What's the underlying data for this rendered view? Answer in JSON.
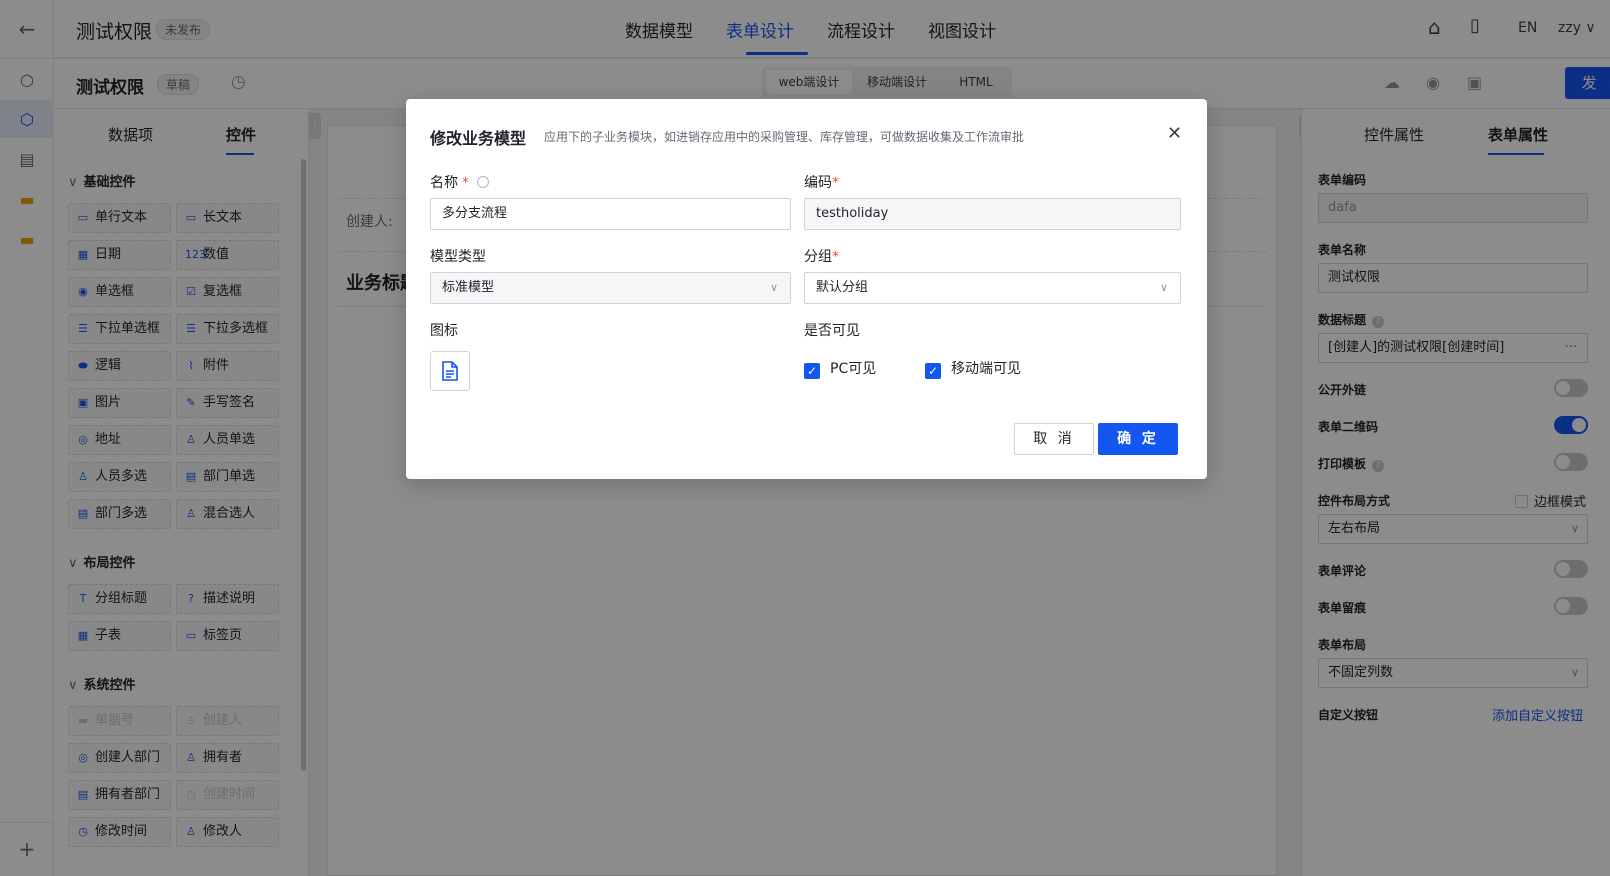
{
  "rail": {
    "back_icon": "arrow-left-icon",
    "search_icon": "search-icon",
    "cube_icon": "cube-icon",
    "doc_icon": "document-icon",
    "folder_icon": "folder-icon",
    "add_icon": "plus-icon",
    "glyphs": {
      "back": "←",
      "search": "○",
      "cube": "⬡",
      "doc": "▤",
      "folder": "▬",
      "add": "+"
    }
  },
  "header": {
    "app_title": "测试权限",
    "status_badge": "未发布",
    "nav_tabs": [
      "数据模型",
      "表单设计",
      "流程设计",
      "视图设计"
    ],
    "active_tab": "表单设计",
    "lang": "EN",
    "user": "zzy ∨",
    "home_glyph": "⌂",
    "book_glyph": "▯"
  },
  "toolbar": {
    "form_title": "测试权限",
    "draft_badge": "草稿",
    "history_glyph": "◷",
    "modes": [
      "web端设计",
      "移动端设计",
      "HTML"
    ],
    "active_mode": "web端设计",
    "icons": {
      "upload": "☁",
      "preview": "◉",
      "save": "▣"
    },
    "publish_label": "发 布"
  },
  "left_panel": {
    "tabs": [
      "数据项",
      "控件"
    ],
    "active_tab": "控件",
    "chevron": "∨",
    "sections": [
      {
        "title": "基础控件",
        "items": [
          {
            "label": "单行文本",
            "glyph": "▭"
          },
          {
            "label": "长文本",
            "glyph": "▭"
          },
          {
            "label": "日期",
            "glyph": "▦"
          },
          {
            "label": "数值",
            "glyph": "123"
          },
          {
            "label": "单选框",
            "glyph": "◉"
          },
          {
            "label": "复选框",
            "glyph": "☑"
          },
          {
            "label": "下拉单选框",
            "glyph": "☰"
          },
          {
            "label": "下拉多选框",
            "glyph": "☰"
          },
          {
            "label": "逻辑",
            "glyph": "⬬"
          },
          {
            "label": "附件",
            "glyph": "⌇"
          },
          {
            "label": "图片",
            "glyph": "▣"
          },
          {
            "label": "手写签名",
            "glyph": "✎"
          },
          {
            "label": "地址",
            "glyph": "◎"
          },
          {
            "label": "人员单选",
            "glyph": "♙"
          },
          {
            "label": "人员多选",
            "glyph": "♙"
          },
          {
            "label": "部门单选",
            "glyph": "▤"
          },
          {
            "label": "部门多选",
            "glyph": "▤"
          },
          {
            "label": "混合选人",
            "glyph": "♙"
          }
        ]
      },
      {
        "title": "布局控件",
        "items": [
          {
            "label": "分组标题",
            "glyph": "T"
          },
          {
            "label": "描述说明",
            "glyph": "?"
          },
          {
            "label": "子表",
            "glyph": "▦"
          },
          {
            "label": "标签页",
            "glyph": "▭"
          }
        ]
      },
      {
        "title": "系统控件",
        "items": [
          {
            "label": "单据号",
            "glyph": "▬",
            "disabled": true
          },
          {
            "label": "创建人",
            "glyph": "♙",
            "disabled": true
          },
          {
            "label": "创建人部门",
            "glyph": "◎"
          },
          {
            "label": "拥有者",
            "glyph": "♙"
          },
          {
            "label": "拥有者部门",
            "glyph": "▤"
          },
          {
            "label": "创建时间",
            "glyph": "◷",
            "disabled": true
          },
          {
            "label": "修改时间",
            "glyph": "◷"
          },
          {
            "label": "修改人",
            "glyph": "♙"
          }
        ]
      }
    ]
  },
  "canvas": {
    "creator_label": "创建人:",
    "business_title": "业务标题"
  },
  "right_panel": {
    "tabs": [
      "控件属性",
      "表单属性"
    ],
    "active_tab": "表单属性",
    "form_code_label": "表单编码",
    "form_code_value": "dafa",
    "form_name_label": "表单名称",
    "form_name_value": "测试权限",
    "data_title_label": "数据标题",
    "data_title_value": "[创建人]的测试权限[创建时间]",
    "public_link_label": "公开外链",
    "public_link_on": false,
    "qrcode_label": "表单二维码",
    "qrcode_on": true,
    "print_template_label": "打印模板",
    "print_template_on": false,
    "layout_mode_label": "控件布局方式",
    "border_mode_label": "边框模式",
    "layout_mode_value": "左右布局",
    "comment_label": "表单评论",
    "comment_on": false,
    "trace_label": "表单留痕",
    "trace_on": false,
    "form_layout_label": "表单布局",
    "form_layout_value": "不固定列数",
    "custom_btn_label": "自定义按钮",
    "add_custom_btn": "添加自定义按钮",
    "help_glyph": "?",
    "dots_glyph": "···",
    "chevron": "∨"
  },
  "modal": {
    "title": "修改业务模型",
    "subtitle": "应用下的子业务模块，如进销存应用中的采购管理、库存管理，可做数据收集及工作流审批",
    "close_glyph": "✕",
    "name_label": "名称",
    "name_value": "多分支流程",
    "code_label": "编码",
    "code_value": "testholiday",
    "model_type_label": "模型类型",
    "model_type_value": "标准模型",
    "group_label": "分组",
    "group_value": "默认分组",
    "icon_label": "图标",
    "visible_label": "是否可见",
    "pc_visible_label": "PC可见",
    "pc_visible": true,
    "mobile_visible_label": "移动端可见",
    "mobile_visible": true,
    "required_mark": "*",
    "check_glyph": "✓",
    "dropdown_glyph": "∨",
    "cancel_label": "取 消",
    "ok_label": "确 定"
  },
  "colors": {
    "accent": "#1456f0",
    "required": "#f54a45",
    "mask": "rgba(0,0,0,0.45)"
  }
}
